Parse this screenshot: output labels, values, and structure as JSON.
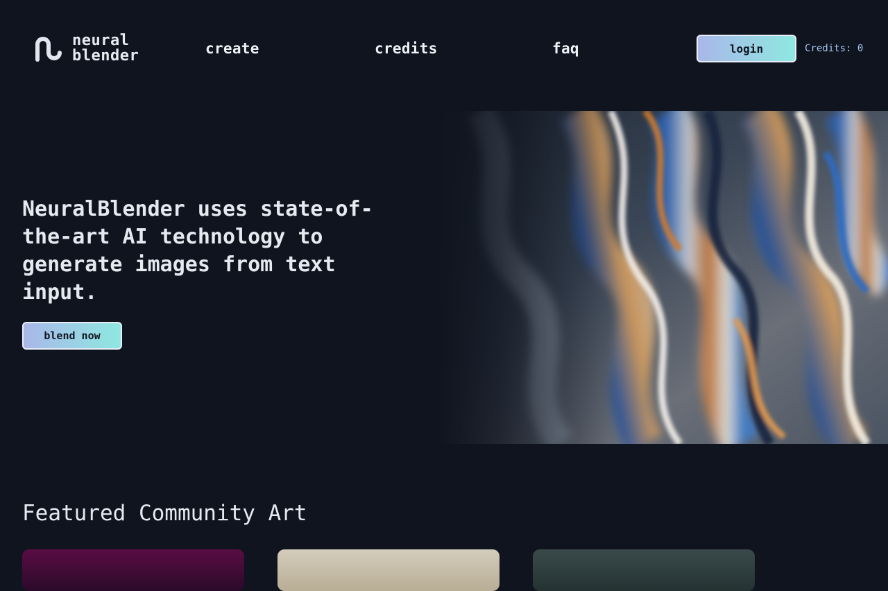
{
  "header": {
    "logo": {
      "line1": "neural",
      "line2": "blender",
      "icon": "wave-logo-icon"
    },
    "nav": [
      {
        "id": "create",
        "label": "create"
      },
      {
        "id": "credits",
        "label": "credits"
      },
      {
        "id": "faq",
        "label": "faq"
      }
    ],
    "login_label": "login",
    "credits_text": "Credits: 0"
  },
  "hero": {
    "heading": "NeuralBlender uses state-of-the-art AI technology to generate images from text input.",
    "cta_label": "blend now",
    "image": "iridescent-liquid-metal-art"
  },
  "featured": {
    "title": "Featured Community Art",
    "cards": [
      {
        "image": "community-art-1"
      },
      {
        "image": "community-art-2"
      },
      {
        "image": "community-art-3"
      }
    ]
  },
  "colors": {
    "background": "#0f141e",
    "button_gradient_start": "#a9b7e9",
    "button_gradient_end": "#8ee8e0",
    "credits_text": "#a6c6f2"
  }
}
